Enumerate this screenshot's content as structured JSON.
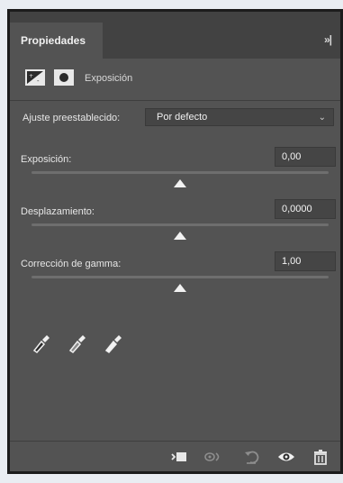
{
  "panel": {
    "tab_label": "Propiedades",
    "collapse_label": "»|",
    "adjustment_title": "Exposición"
  },
  "preset": {
    "label": "Ajuste preestablecido:",
    "value": "Por defecto"
  },
  "controls": [
    {
      "label": "Exposición:",
      "value": "0,00",
      "slider_fraction": 0.5
    },
    {
      "label": "Desplazamiento:",
      "value": "0,0000",
      "slider_fraction": 0.5
    },
    {
      "label": "Corrección de gamma:",
      "value": "1,00",
      "slider_fraction": 0.5
    }
  ],
  "eyedroppers": [
    "sample-black-eyedropper-icon",
    "sample-gray-eyedropper-icon",
    "sample-white-eyedropper-icon"
  ],
  "footer_icons": [
    "clip-to-layer-icon",
    "view-previous-state-icon",
    "reset-icon",
    "visibility-eye-icon",
    "delete-trash-icon"
  ],
  "colors": {
    "panel_bg": "#535353",
    "tabbar_bg": "#424242",
    "field_bg": "#454545",
    "text": "#e6e6e6"
  }
}
